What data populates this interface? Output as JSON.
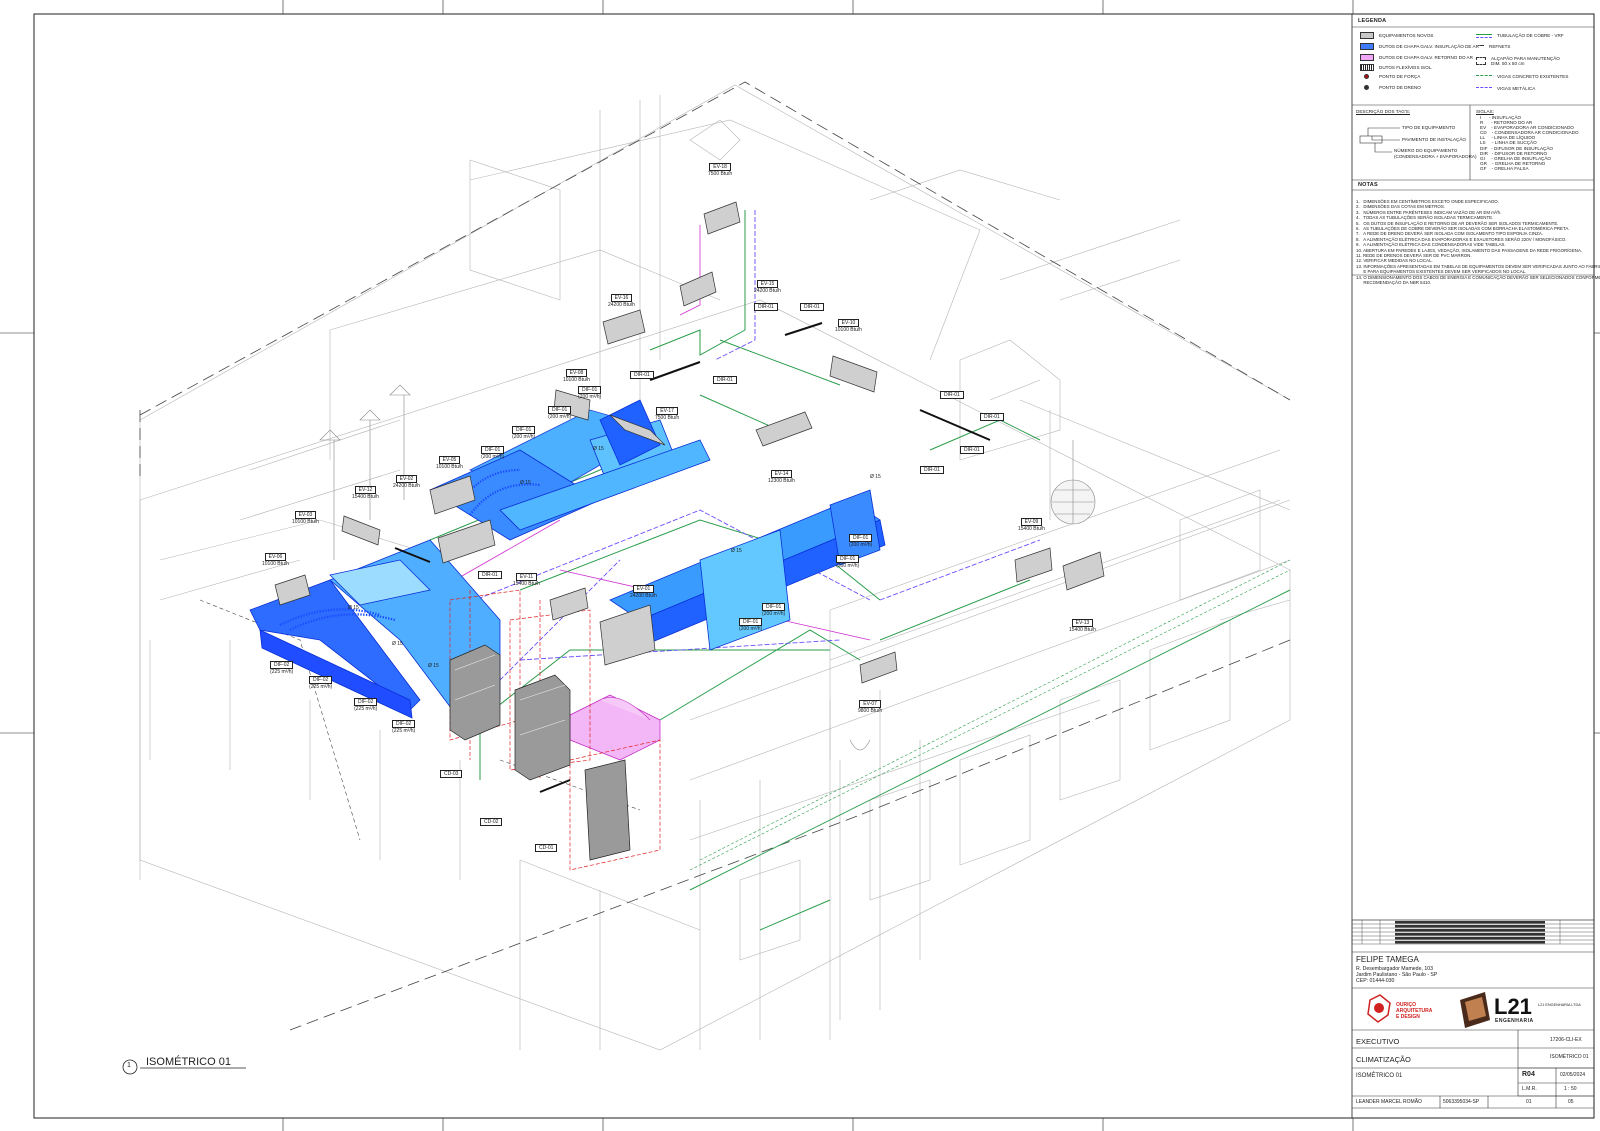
{
  "view": {
    "number": "1",
    "title": "ISOMÉTRICO 01"
  },
  "legend": {
    "header": "LEGENDA",
    "items_left": [
      {
        "label": "EQUIPAMENTOS NOVOS",
        "color": "#c8c8c8"
      },
      {
        "label": "DUTOS DE CHAPA GALV. INSUFLAÇÃO DE AR",
        "color": "#3f7bff"
      },
      {
        "label": "DUTOS DE CHAPA GALV. RETORNO DO AR",
        "color": "#f0a8f6"
      },
      {
        "label": "DUTOS FLEXÍVEIS ISOL.",
        "color": "#555555"
      },
      {
        "label": "PONTO DE FORÇA",
        "color": "#b01010"
      },
      {
        "label": "PONTO DE DRENO",
        "color": "#333333"
      }
    ],
    "items_right": [
      {
        "label": "TUBULAÇÃO DE COBRE - VRF",
        "color": "#2a9d4a"
      },
      {
        "label": "REFNETS",
        "color": "#333333"
      },
      {
        "label": "ALÇAPÃO PARA MANUTENÇÃO DIM. 50 x 50 cm",
        "color": "#333333"
      },
      {
        "label": "VIGAS CONCRETO EXISTENTES",
        "color": "#2a9d4a"
      },
      {
        "label": "VIGAS METÁLICA",
        "color": "#6a4cff"
      }
    ]
  },
  "tag_description": {
    "header": "DESCRIÇÃO DOS TAG'S:",
    "lines": [
      "TIPO DE EQUIPAMENTO",
      "PAVIMENTO DE INSTALAÇÃO",
      "NÚMERO DO EQUIPAMENTO",
      "(CONDENSADORA + EVAPORADORA)"
    ]
  },
  "abbreviations": {
    "header": "SIGLAS:",
    "lines": [
      "I      - INSUFLAÇÃO",
      "R      - RETORNO DO AR",
      "EV    - EVAPORADORA AR CONDICIONADO",
      "CD    - CONDENSADORA AR CONDICIONADO",
      "LL     - LINHA DE LÍQUIDO",
      "LS     - LINHA DE SUCÇÃO",
      "DIF   - DIFUSOR DE INSUFLAÇÃO",
      "DIR   - DIFUSOR DE RETORNO",
      "GI     - GRELHA DE INSUFLAÇÃO",
      "GR    - GRELHA DE RETORNO",
      "GF    - GRELHA FALSA"
    ]
  },
  "notes": {
    "header": "NOTAS",
    "lines": [
      "1.   DIMENSÕES EM CENTÍMETROS EXCETO ONDE ESPECIFICADO.",
      "2.   DIMENSÕES DAS COTAS EM METROS.",
      "3.   NÚMEROS ENTRE PARÊNTESES INDICAM VAZÃO DE AR EM m³/h.",
      "4.   TODAS AS TUBULAÇÕES SERÃO ISOLADAS TERMICAMENTE.",
      "5.   OS DUTOS DE INSUFLAÇÃO E RETORNO DE AR DEVERÃO SER ISOLADOS TERMICAMENTE.",
      "6.   AS TUBULAÇÕES DE COBRE DEVERÃO SER ISOLADAS COM BORRACHA ELASTOMÉRICA PRETA.",
      "7.   A REDE DE DRENO DEVERÁ SER ISOLADA COM ISOLAMENTO TIPO ESPONJA CINZA.",
      "8.   A ALIMENTAÇÃO ELÉTRICA DAS EVAPORADORAS E EXAUSTORES SERÃO 220V / MONOFÁSICO.",
      "9.   A ALIMENTAÇÃO ELÉTRICA DAS CONDENSADORAS VIDE TABELAS.",
      "10. ABERTURA EM PAREDES E LAJES, VEDAÇÃO, ISOLAMENTO DAS PASSAGENS DA REDE FRIGORÍGENA.",
      "11. REDE DE DRENOS DEVERÁ SER DE PVC MARRON.",
      "12. VERIFICAR MEDIDAS NO LOCAL.",
      "13. INFORMAÇÕES APRESENTADAS EM TABELAS DE EQUIPAMENTOS DEVEM SER VERIFICADAS JUNTO AO FABRICANTE",
      "      E PARA EQUIPAMENTOS EXISTENTES DEVEM SER VERIFICADOS NO LOCAL.",
      "14. O DIMENSIONAMENTO DOS CABOS DE ENERGIA E COMUNICAÇÃO DEVERÃO SER SELECIONADOS CONFORME",
      "      RECOMENDAÇÃO DA NBR 5410."
    ]
  },
  "client": {
    "name": "FELIPE TAMEGA",
    "address1": "R. Desembargador Mamede, 103",
    "address2": "Jardim Paulistano - São Paulo - SP",
    "cep": "CEP: 01444-030"
  },
  "logos": {
    "architect": "OURIÇO ARQUITETURA E DESIGN",
    "engineering_mark": "L21",
    "engineering_sub": "ENGENHARIA",
    "engineering_name": "L21 ENGENHARIA LTDA"
  },
  "titleblock": {
    "phase": "EXECUTIVO",
    "project_code": "17206-CLI-EX",
    "discipline": "CLIMATIZAÇÃO",
    "sheet_title": "ISOMÉTRICO 01",
    "revision": "R04",
    "date": "02/05/2024",
    "drawn_by": "L.M.R.",
    "scale": "1 : 50",
    "engineer": "LEANDER MARCEL ROMÃO",
    "crea": "5063395034-SP",
    "sheet_no": "01",
    "sheet_total": "05"
  },
  "equipment_tags": [
    {
      "tag": "EV-18",
      "cap": "7500 Btu/h"
    },
    {
      "tag": "EV-15",
      "cap": "24200 Btu/h"
    },
    {
      "tag": "EV-16",
      "cap": "24200 Btu/h"
    },
    {
      "tag": "EV-10",
      "cap": "10100 Btu/h"
    },
    {
      "tag": "EV-08",
      "cap": "10100 Btu/h"
    },
    {
      "tag": "EV-17",
      "cap": "7500 Btu/h"
    },
    {
      "tag": "EV-14",
      "cap": "12300 Btu/h"
    },
    {
      "tag": "EV-05",
      "cap": "10100 Btu/h"
    },
    {
      "tag": "EV-02",
      "cap": "24200 Btu/h"
    },
    {
      "tag": "EV-12",
      "cap": "15400 Btu/h"
    },
    {
      "tag": "EV-03",
      "cap": "10100 Btu/h"
    },
    {
      "tag": "EV-06",
      "cap": "10100 Btu/h"
    },
    {
      "tag": "EV-11",
      "cap": "15400 Btu/h"
    },
    {
      "tag": "EV-01",
      "cap": "24200 Btu/h"
    },
    {
      "tag": "EV-09",
      "cap": "15400 Btu/h"
    },
    {
      "tag": "EV-13",
      "cap": "15400 Btu/h"
    },
    {
      "tag": "EV-07",
      "cap": "9800 Btu/h"
    }
  ],
  "diffuser_tags": [
    {
      "tag": "DIR-01",
      "cap": ""
    },
    {
      "tag": "DIR-01",
      "cap": ""
    },
    {
      "tag": "DIR-01",
      "cap": ""
    },
    {
      "tag": "DIR-01",
      "cap": ""
    },
    {
      "tag": "DIR-01",
      "cap": ""
    },
    {
      "tag": "DIR-01",
      "cap": ""
    },
    {
      "tag": "DIR-01",
      "cap": ""
    },
    {
      "tag": "DIR-01",
      "cap": ""
    },
    {
      "tag": "DIF-01",
      "cap": "(200 m³/h)"
    },
    {
      "tag": "DIF-01",
      "cap": "(200 m³/h)"
    },
    {
      "tag": "DIF-01",
      "cap": "(200 m³/h)"
    },
    {
      "tag": "DIF-01",
      "cap": "(200 m³/h)"
    },
    {
      "tag": "DIF-01",
      "cap": "(200 m³/h)"
    },
    {
      "tag": "DIF-01",
      "cap": "(200 m³/h)"
    },
    {
      "tag": "DIF-01",
      "cap": "(200 m³/h)"
    },
    {
      "tag": "DIF-01",
      "cap": "(200 m³/h)"
    },
    {
      "tag": "DIF-02",
      "cap": "(225 m³/h)"
    },
    {
      "tag": "DIF-02",
      "cap": "(225 m³/h)"
    },
    {
      "tag": "DIF-02",
      "cap": "(225 m³/h)"
    },
    {
      "tag": "DIF-02",
      "cap": "(225 m³/h)"
    }
  ],
  "condenser_tags": [
    "CD-03",
    "CD-02",
    "CD-01"
  ],
  "pipe_sizes": [
    "Ø 15",
    "Ø 15",
    "Ø 15",
    "Ø 15",
    "Ø 15",
    "Ø 15",
    "Ø 15"
  ]
}
